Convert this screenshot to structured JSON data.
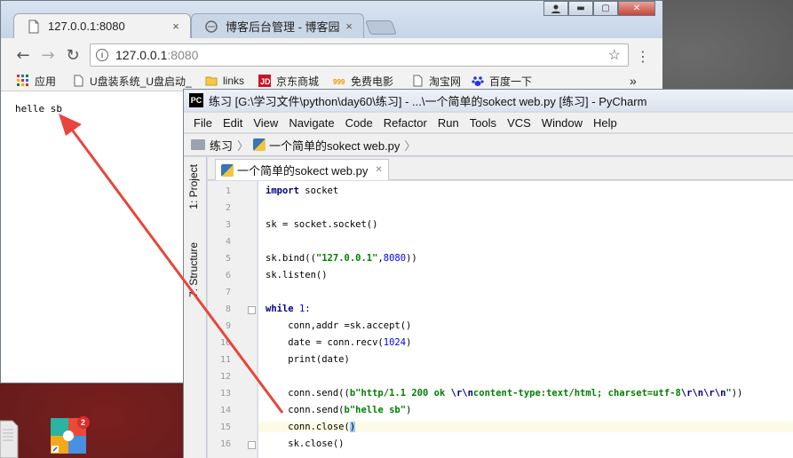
{
  "browser": {
    "tabs": [
      {
        "label": "127.0.0.1:8080",
        "icon": "page-icon"
      },
      {
        "label": "博客后台管理 - 博客园",
        "icon": "cnblogs-icon"
      }
    ],
    "tab_close": "×",
    "address": {
      "host": "127.0.0.1",
      "port": ":8080"
    },
    "bookmarks": [
      {
        "label": "应用",
        "icon": "apps-grid-icon"
      },
      {
        "label": "U盘装系统_U盘启动_",
        "icon": "page-icon"
      },
      {
        "label": "links",
        "icon": "folder-icon"
      },
      {
        "label": "京东商城",
        "icon": "jd-icon"
      },
      {
        "label": "免费电影",
        "icon": "movie-icon"
      },
      {
        "label": "淘宝网",
        "icon": "page-icon"
      },
      {
        "label": "百度一下",
        "icon": "baidu-icon"
      }
    ],
    "bookmarks_overflow": "»",
    "page_text": "helle sb"
  },
  "pycharm": {
    "title": "练习 [G:\\学习文件\\python\\day60\\练习] - ...\\一个简单的sokect web.py [练习] - PyCharm",
    "menu": [
      "File",
      "Edit",
      "View",
      "Navigate",
      "Code",
      "Refactor",
      "Run",
      "Tools",
      "VCS",
      "Window",
      "Help"
    ],
    "breadcrumb": [
      "练习",
      "一个简单的sokect web.py"
    ],
    "side_tabs": [
      "1: Project",
      "7: Structure"
    ],
    "editor_tab": "一个简单的sokect web.py",
    "line_numbers": [
      "1",
      "2",
      "3",
      "4",
      "5",
      "6",
      "7",
      "8",
      "9",
      "10",
      "11",
      "12",
      "13",
      "14",
      "15",
      "16"
    ],
    "code": {
      "l1_kw": "import",
      "l1_rest": " socket",
      "l3": "sk = socket.socket()",
      "l5_a": "sk.bind((",
      "l5_str": "\"127.0.0.1\"",
      "l5_b": ",",
      "l5_num": "8080",
      "l5_c": "))",
      "l6": "sk.listen()",
      "l8_kw": "while",
      "l8_sp": " ",
      "l8_num": "1",
      "l8_c": ":",
      "l9": "    conn,addr =sk.accept()",
      "l10_a": "    date = conn.recv(",
      "l10_num": "1024",
      "l10_b": ")",
      "l11": "    print(date)",
      "l13_a": "    conn.send((",
      "l13_s1": "b\"http/1.1 200 ok ",
      "l13_e1": "\\r\\n",
      "l13_s2": "content-type:text/html; charset=utf-8",
      "l13_e2": "\\r\\n\\r\\n",
      "l13_s3": "\"",
      "l13_b": "))",
      "l14_a": "    conn.send(",
      "l14_str": "b\"helle sb\"",
      "l14_b": ")",
      "l15_a": "    conn.close(",
      "l15_b": ")",
      "l16": "    sk.close()"
    }
  },
  "colors": {
    "arrow": "#e8453c",
    "keyword": "#000080",
    "string": "#008000",
    "number": "#0000ff",
    "current_line": "#fcfbe5"
  }
}
